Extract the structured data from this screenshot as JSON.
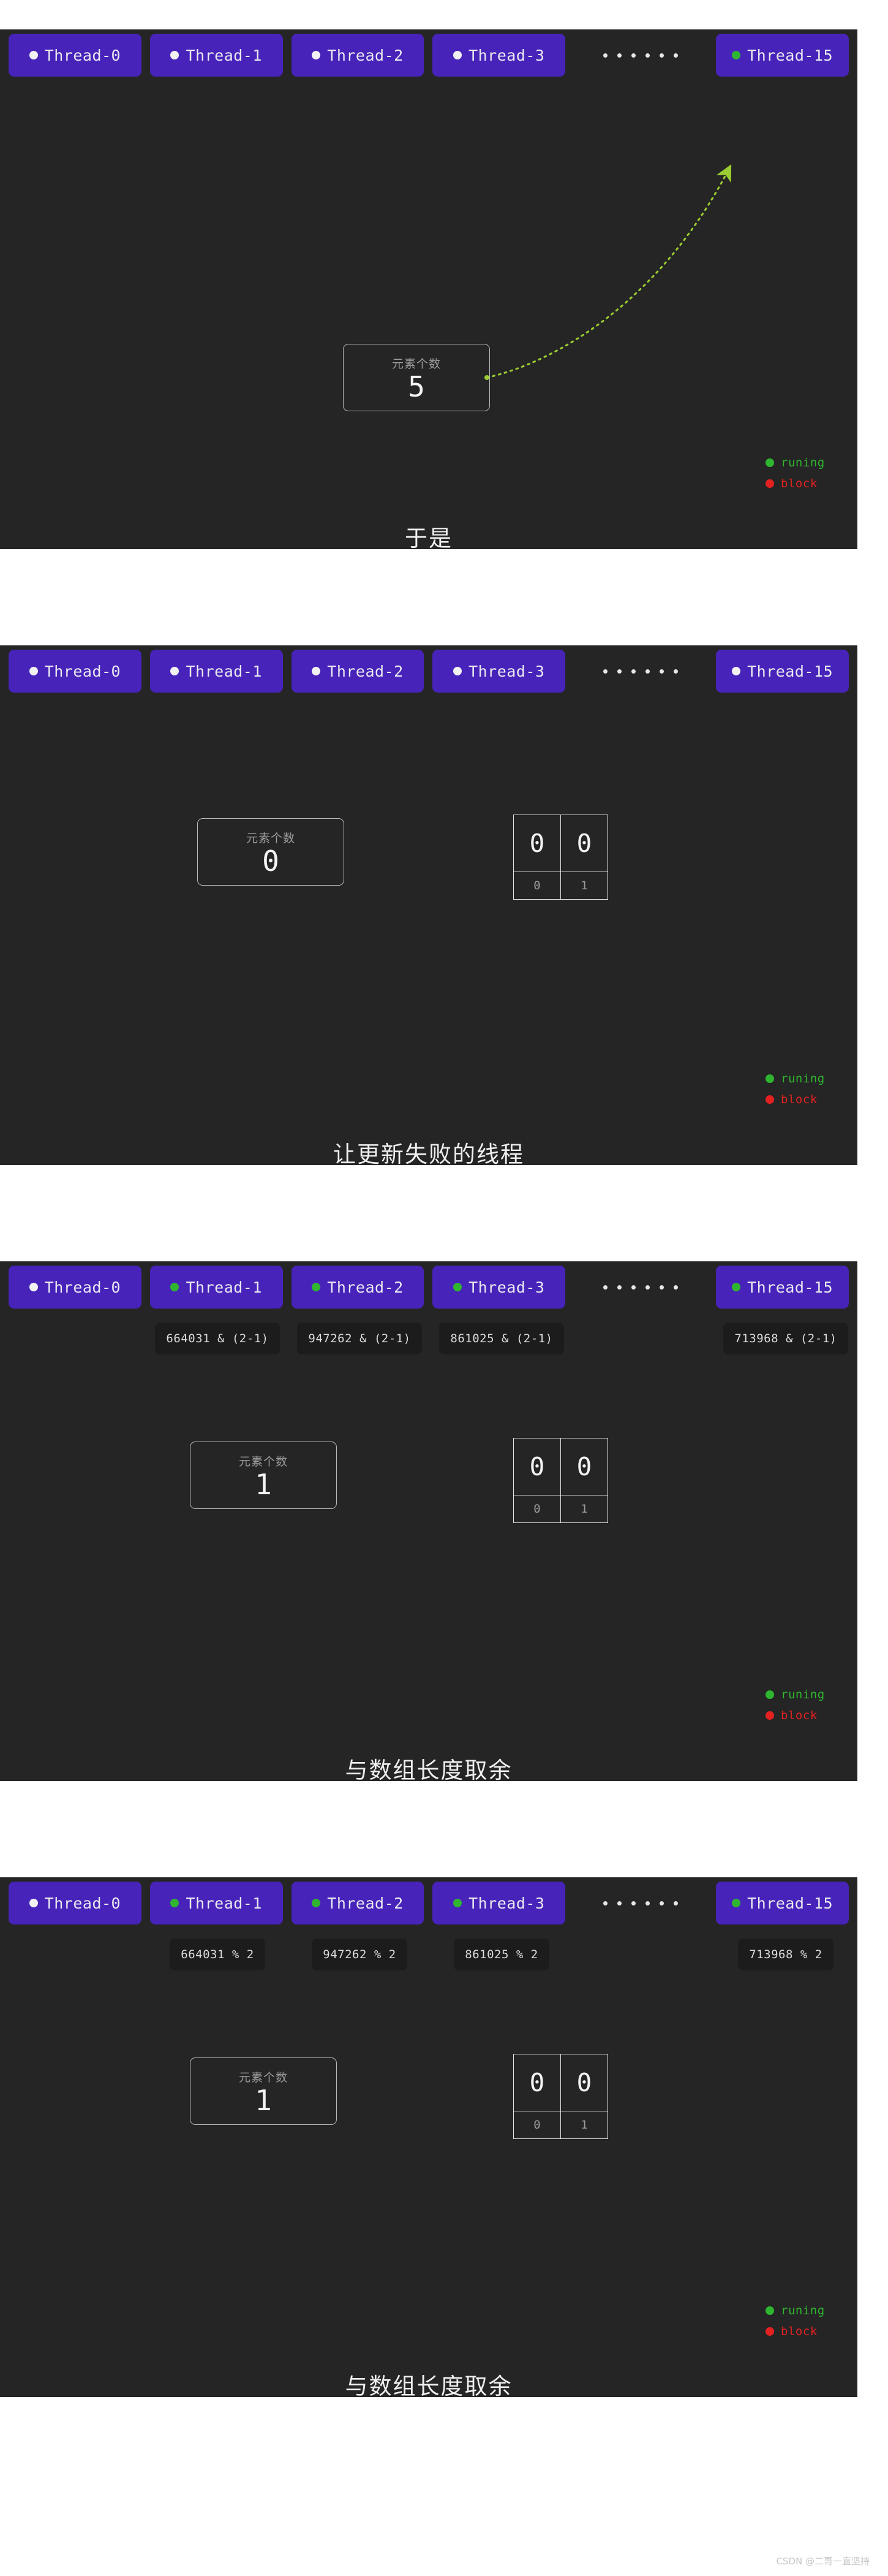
{
  "colors": {
    "panel_bg": "#252525",
    "page_bg": "#ffffff",
    "thread_btn": "#4723ba",
    "running": "#2fb52f",
    "blocked": "#e32121",
    "idle": "#f2f2f2",
    "arrow": "#9acd32",
    "chip_bg": "#1c1c1c"
  },
  "counter_label": "元素个数",
  "legend": {
    "running": {
      "label": "runing",
      "dot": "green"
    },
    "blocked": {
      "label": "block",
      "dot": "red"
    }
  },
  "ellipsis_dots": 6,
  "array": {
    "indices": [
      "0",
      "1"
    ],
    "values": [
      "0",
      "0"
    ]
  },
  "panels": [
    {
      "id": "panel-1",
      "caption": "于是",
      "counter_value": "5",
      "has_array": false,
      "has_formulas": false,
      "has_arrow": true,
      "threads": [
        {
          "label": "Thread-0",
          "state": "idle"
        },
        {
          "label": "Thread-1",
          "state": "idle"
        },
        {
          "label": "Thread-2",
          "state": "idle"
        },
        {
          "label": "Thread-3",
          "state": "idle"
        },
        {
          "label": "ellipsis",
          "state": "none"
        },
        {
          "label": "Thread-15",
          "state": "running"
        }
      ],
      "formulas": []
    },
    {
      "id": "panel-2",
      "caption": "让更新失败的线程",
      "counter_value": "0",
      "has_array": true,
      "has_formulas": false,
      "has_arrow": false,
      "threads": [
        {
          "label": "Thread-0",
          "state": "idle"
        },
        {
          "label": "Thread-1",
          "state": "idle"
        },
        {
          "label": "Thread-2",
          "state": "idle"
        },
        {
          "label": "Thread-3",
          "state": "idle"
        },
        {
          "label": "ellipsis",
          "state": "none"
        },
        {
          "label": "Thread-15",
          "state": "idle"
        }
      ],
      "formulas": []
    },
    {
      "id": "panel-3",
      "caption": "与数组长度取余",
      "counter_value": "1",
      "has_array": true,
      "has_formulas": true,
      "has_arrow": false,
      "threads": [
        {
          "label": "Thread-0",
          "state": "idle"
        },
        {
          "label": "Thread-1",
          "state": "running"
        },
        {
          "label": "Thread-2",
          "state": "running"
        },
        {
          "label": "Thread-3",
          "state": "running"
        },
        {
          "label": "ellipsis",
          "state": "none"
        },
        {
          "label": "Thread-15",
          "state": "running"
        }
      ],
      "formulas": [
        "",
        "664031 & (2-1)",
        "947262 & (2-1)",
        "861025 & (2-1)",
        "",
        "713968 & (2-1)"
      ]
    },
    {
      "id": "panel-4",
      "caption": "与数组长度取余",
      "counter_value": "1",
      "has_array": true,
      "has_formulas": true,
      "has_arrow": false,
      "threads": [
        {
          "label": "Thread-0",
          "state": "idle"
        },
        {
          "label": "Thread-1",
          "state": "running"
        },
        {
          "label": "Thread-2",
          "state": "running"
        },
        {
          "label": "Thread-3",
          "state": "running"
        },
        {
          "label": "ellipsis",
          "state": "none"
        },
        {
          "label": "Thread-15",
          "state": "running"
        }
      ],
      "formulas": [
        "",
        "664031 % 2",
        "947262 % 2",
        "861025 % 2",
        "",
        "713968 % 2"
      ]
    }
  ],
  "watermark": "CSDN @二哥一直坚持"
}
